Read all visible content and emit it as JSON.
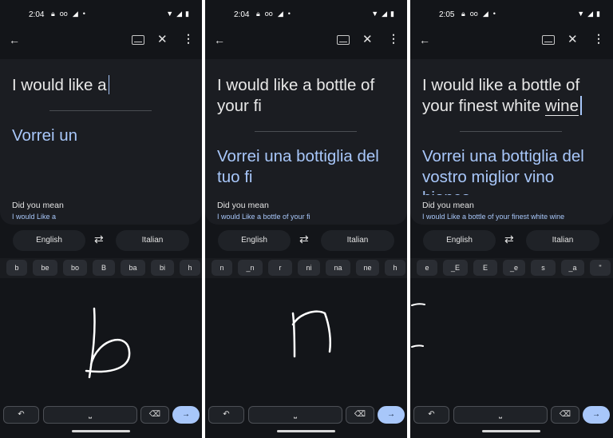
{
  "panels": [
    {
      "status": {
        "time": "2:04"
      },
      "source": {
        "text": "I would like a",
        "underlined": ""
      },
      "translation": "Vorrei un",
      "did_you_mean": {
        "label": "Did you mean",
        "suggestion": "I would Like a"
      },
      "languages": {
        "source": "English",
        "target": "Italian"
      },
      "candidates": [
        "b",
        "be",
        "bo",
        "B",
        "ba",
        "bi",
        "h"
      ],
      "handwriting": "b"
    },
    {
      "status": {
        "time": "2:04"
      },
      "source": {
        "text": "I would like a bottle of your fi",
        "underlined": ""
      },
      "translation": "Vorrei una bottiglia del tuo fi",
      "did_you_mean": {
        "label": "Did you mean",
        "suggestion": "I would Like a bottle of your fi"
      },
      "languages": {
        "source": "English",
        "target": "Italian"
      },
      "candidates": [
        "n",
        "_n",
        "r",
        "ni",
        "na",
        "ne",
        "h"
      ],
      "handwriting": "n"
    },
    {
      "status": {
        "time": "2:05"
      },
      "source": {
        "text": "I would like a bottle of your finest white ",
        "underlined": "wine"
      },
      "translation": "Vorrei una bottiglia del vostro miglior vino bianco",
      "did_you_mean": {
        "label": "Did you mean",
        "suggestion": "I would Like a bottle of your finest white wine"
      },
      "languages": {
        "source": "English",
        "target": "Italian"
      },
      "candidates": [
        "e",
        "_E",
        "E",
        "_e",
        "s",
        "_a",
        "\""
      ],
      "handwriting": "E"
    }
  ],
  "icons": {
    "back": "←",
    "keyboard": "keyboard-icon",
    "close": "✕",
    "more": "⋮",
    "swap": "⇄",
    "undo": "↶",
    "space": "⎵",
    "backspace": "⌫",
    "enter": "→"
  },
  "colors": {
    "background": "#131519",
    "card": "#1b1d22",
    "accent": "#a8c7fa"
  }
}
